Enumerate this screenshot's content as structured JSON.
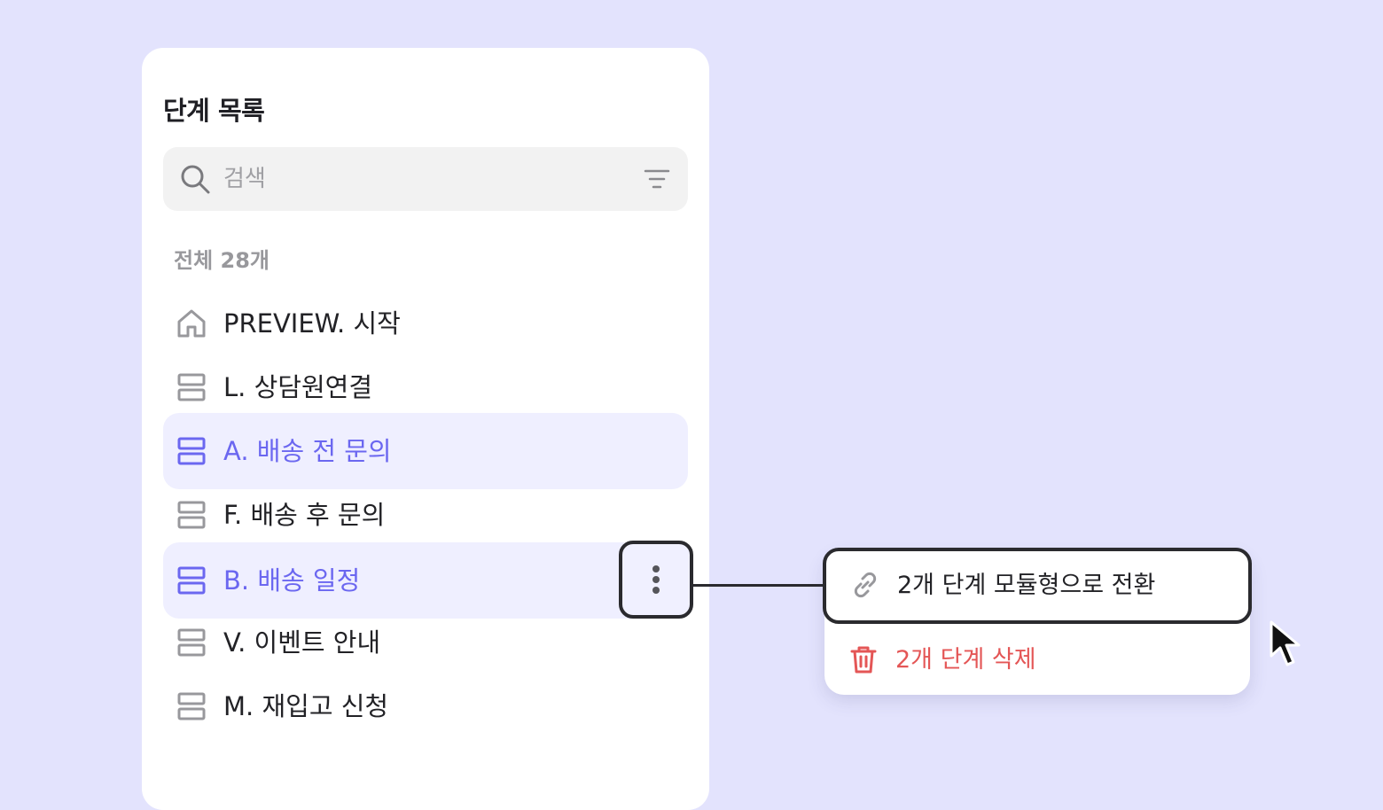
{
  "panel": {
    "title": "단계 목록",
    "search_placeholder": "검색",
    "count_label": "전체 28개"
  },
  "steps": [
    {
      "label": "PREVIEW. 시작",
      "icon": "home-icon",
      "selected": false
    },
    {
      "label": "L. 상담원연결",
      "icon": "module-icon",
      "selected": false
    },
    {
      "label": "A. 배송 전 문의",
      "icon": "module-icon",
      "selected": true
    },
    {
      "label": "F. 배송 후 문의",
      "icon": "module-icon",
      "selected": false
    },
    {
      "label": "B. 배송 일정",
      "icon": "module-icon",
      "selected": true
    },
    {
      "label": "V. 이벤트 안내",
      "icon": "module-icon",
      "selected": false
    },
    {
      "label": "M. 재입고 신청",
      "icon": "module-icon",
      "selected": false
    }
  ],
  "context_menu": {
    "items": [
      {
        "label": "2개 단계 모듈형으로 전환",
        "icon": "link-icon"
      },
      {
        "label": "2개 단계 삭제",
        "icon": "trash-icon"
      }
    ]
  },
  "colors": {
    "background": "#e3e3fd",
    "accent": "#6b67f0",
    "selected_row": "#efefff",
    "danger": "#e45656",
    "icon_gray": "#98989c"
  }
}
